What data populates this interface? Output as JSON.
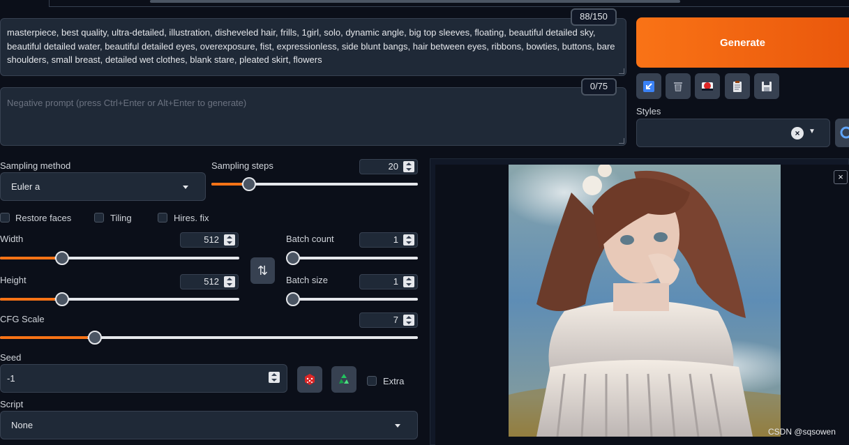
{
  "prompt": {
    "counter": "88/150",
    "text": "masterpiece, best quality, ultra-detailed, illustration, disheveled hair, frills, 1girl, solo, dynamic angle, big top sleeves, floating, beautiful detailed sky, beautiful detailed water, beautiful detailed eyes, overexposure, fist, expressionless, side blunt bangs, hair between eyes, ribbons, bowties, buttons, bare shoulders, small breast, detailed wet clothes, blank stare, pleated skirt, flowers"
  },
  "negative_prompt": {
    "counter": "0/75",
    "placeholder": "Negative prompt (press Ctrl+Enter or Alt+Enter to generate)"
  },
  "generate_label": "Generate",
  "toolbar": {
    "icons": [
      "arrow-icon",
      "trash-icon",
      "red-circle-icon",
      "clipboard-icon",
      "save-icon"
    ]
  },
  "styles": {
    "label": "Styles",
    "clear": "×"
  },
  "sampling": {
    "method_label": "Sampling method",
    "method_value": "Euler a",
    "steps_label": "Sampling steps",
    "steps_value": "20",
    "steps_fraction": 0.15
  },
  "checkboxes": {
    "restore_faces": "Restore faces",
    "tiling": "Tiling",
    "hires_fix": "Hires. fix"
  },
  "width": {
    "label": "Width",
    "value": "512",
    "fraction": 0.23
  },
  "height": {
    "label": "Height",
    "value": "512",
    "fraction": 0.23
  },
  "batch_count": {
    "label": "Batch count",
    "value": "1",
    "fraction": 0.0
  },
  "batch_size": {
    "label": "Batch size",
    "value": "1",
    "fraction": 0.0
  },
  "cfg": {
    "label": "CFG Scale",
    "value": "7",
    "fraction": 0.21
  },
  "swap_icon": "⇅",
  "seed": {
    "label": "Seed",
    "value": "-1",
    "extra_label": "Extra"
  },
  "script": {
    "label": "Script",
    "value": "None"
  },
  "gallery": {
    "close": "×",
    "watermark": "CSDN @sqsowen"
  },
  "colors": {
    "accent": "#f97316",
    "background": "#0b0f19",
    "panel": "#1f2937"
  }
}
